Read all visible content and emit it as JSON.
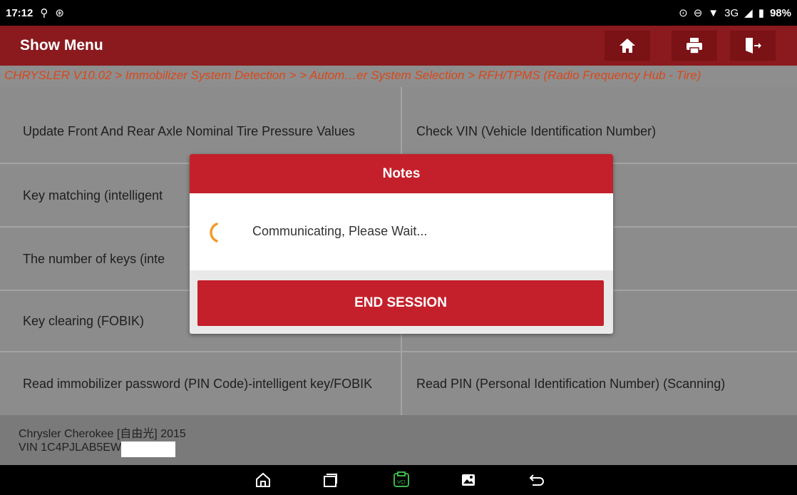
{
  "status": {
    "time": "17:12",
    "network": "3G",
    "battery": "98%"
  },
  "header": {
    "title": "Show Menu",
    "icons": [
      "home-icon",
      "print-icon",
      "exit-icon"
    ]
  },
  "breadcrumb": "CHRYSLER V10.02 > Immobilizer System Detection > > Autom…er System Selection > RFH/TPMS (Radio Frequency Hub - Tire)",
  "menu": {
    "left": [
      "Update Front And Rear Axle Nominal Tire Pressure Values",
      "Key matching (intelligent",
      "The number of keys (inte",
      "Key clearing (FOBIK)",
      "Read immobilizer password (PIN Code)-intelligent key/FOBIK"
    ],
    "right": [
      "Check VIN (Vehicle Identification Number)",
      "",
      "",
      "",
      "Read PIN (Personal Identification Number) (Scanning)"
    ]
  },
  "vehicle": {
    "model": "Chrysler Cherokee [自由光] 2015",
    "vin": "VIN 1C4PJLAB5EW"
  },
  "dialog": {
    "title": "Notes",
    "message": "Communicating, Please Wait...",
    "button": "END SESSION"
  },
  "colors": {
    "accent_red": "#c4202b",
    "header_dark_red": "#8a1a1e",
    "breadcrumb_orange": "#d9481b",
    "spinner_orange": "#f39a2b"
  }
}
